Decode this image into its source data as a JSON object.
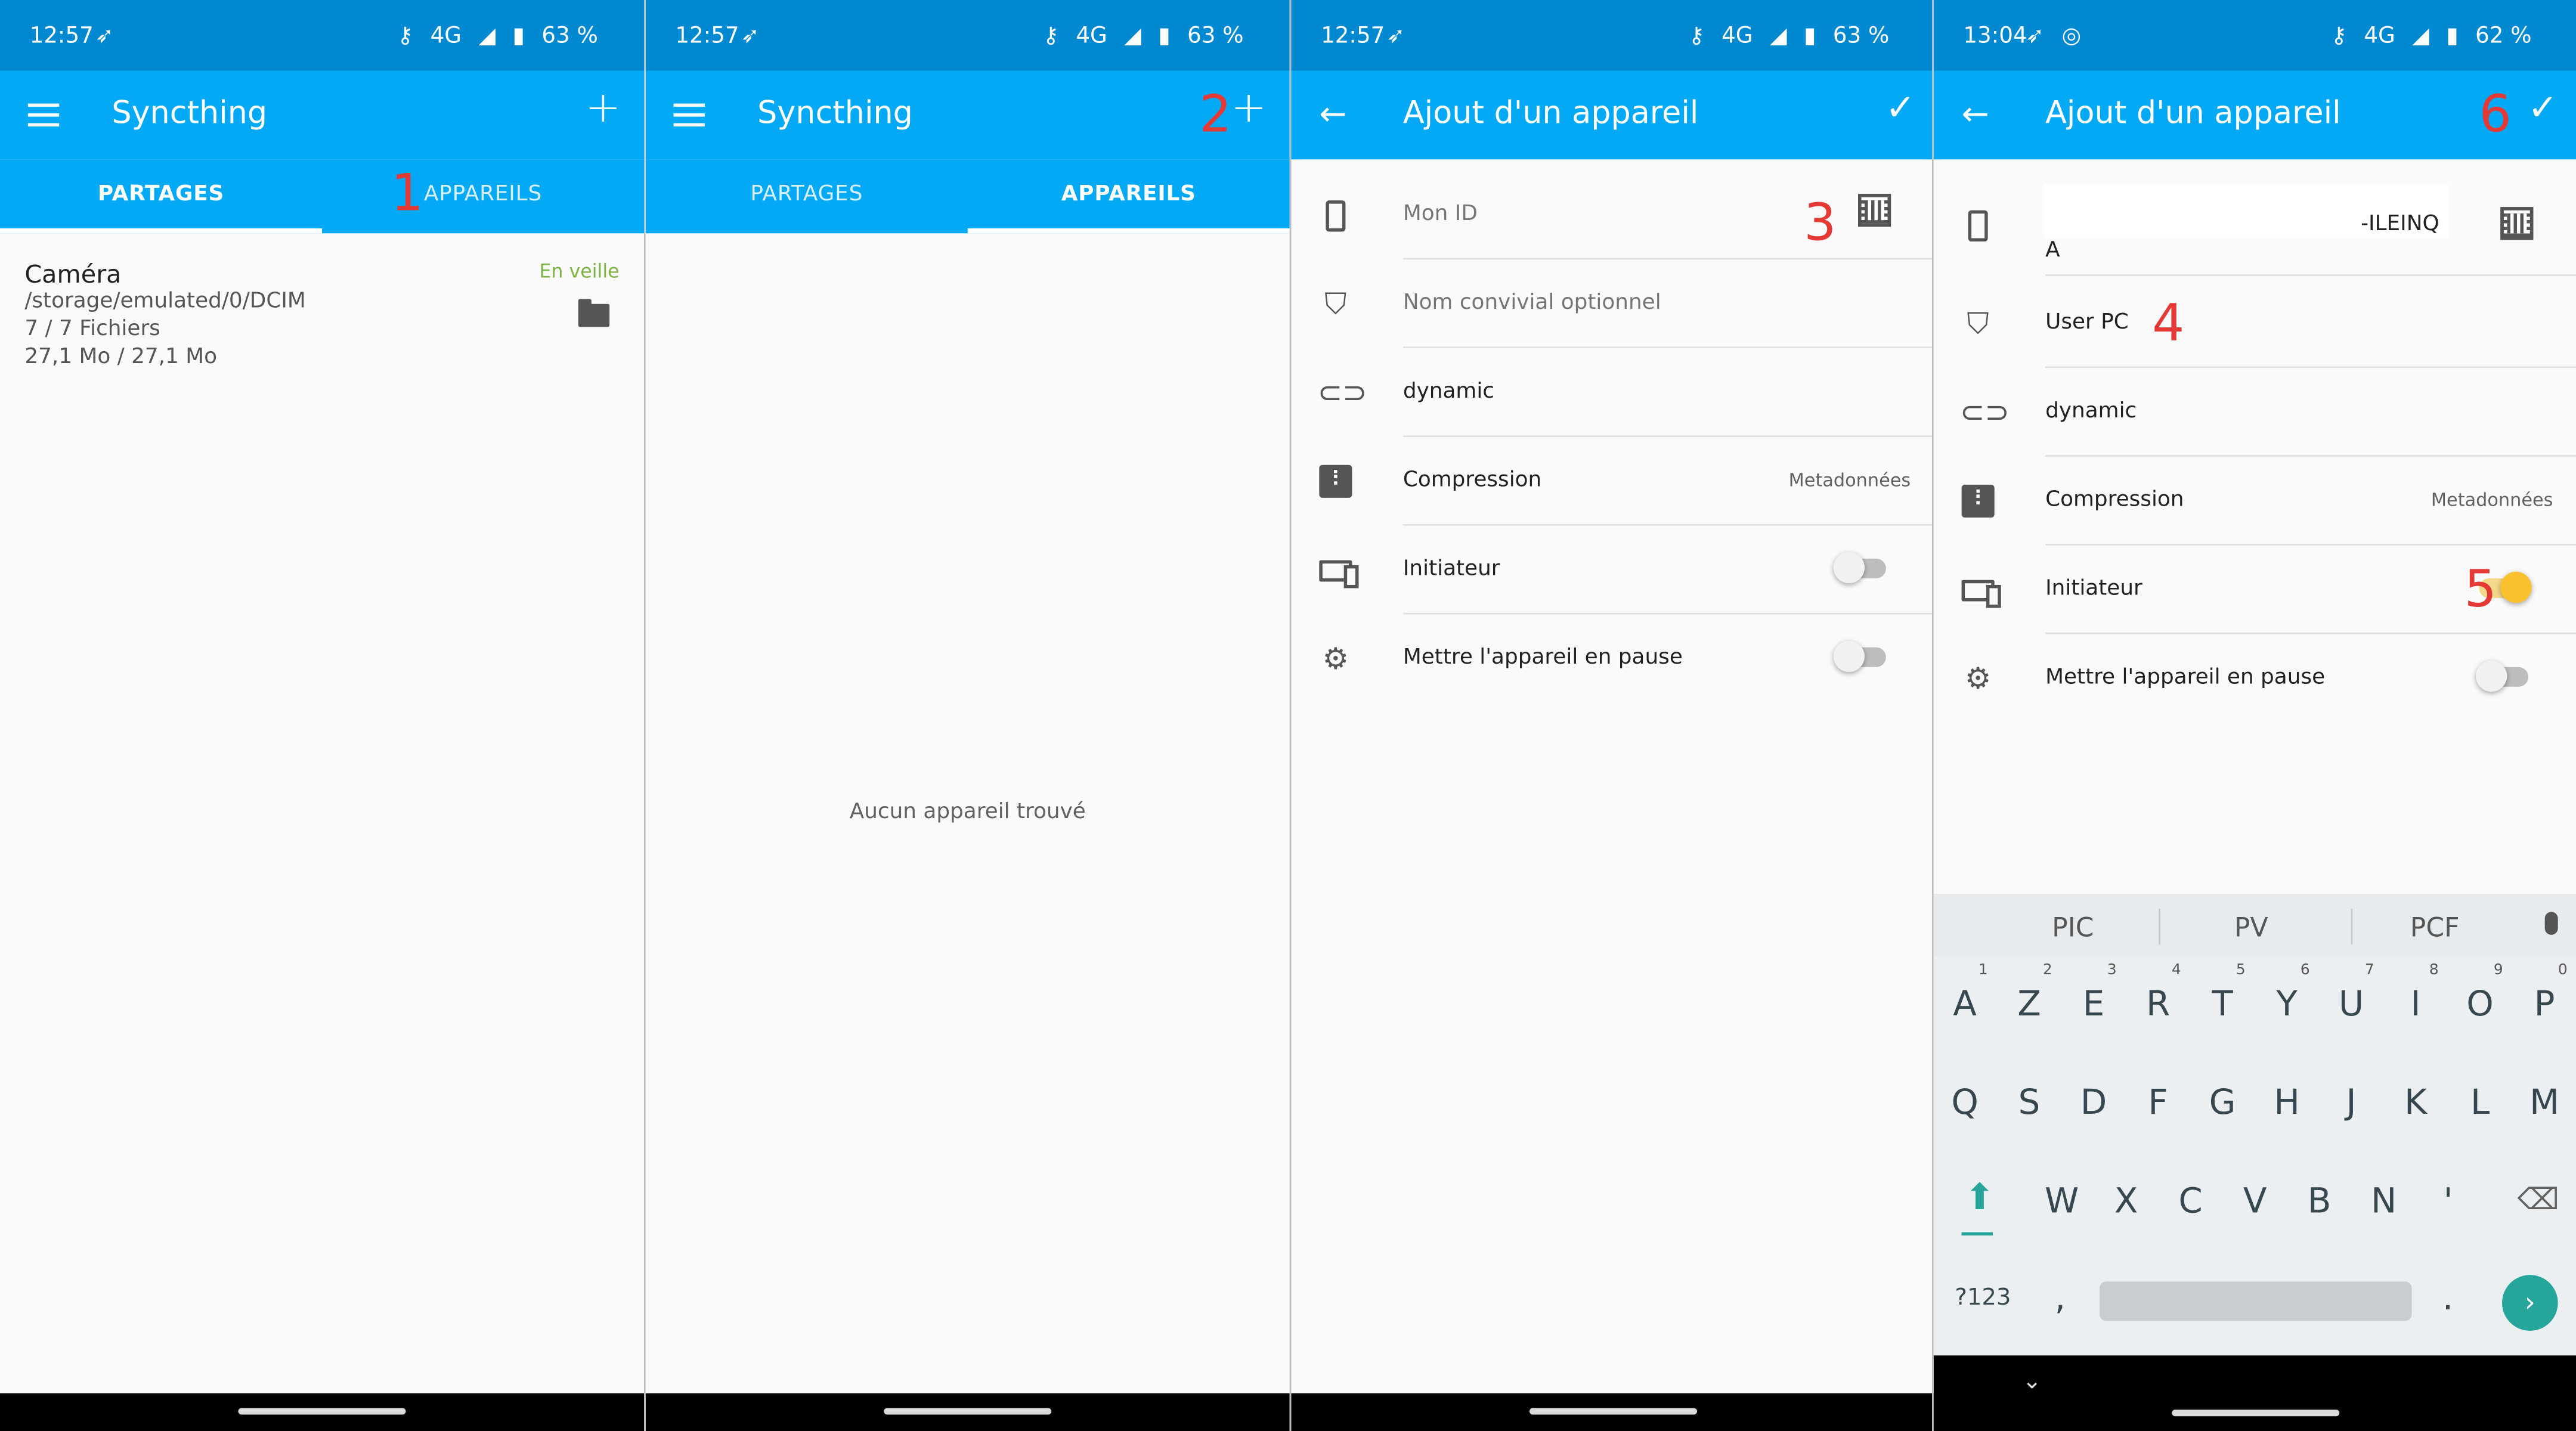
{
  "status_bars": [
    {
      "time": "12:57",
      "signal": "4G",
      "battery": "63 %"
    },
    {
      "time": "12:57",
      "signal": "4G",
      "battery": "63 %"
    },
    {
      "time": "12:57",
      "signal": "4G",
      "battery": "63 %"
    },
    {
      "time": "13:04",
      "signal": "4G",
      "battery": "62 %"
    }
  ],
  "screen1": {
    "title": "Syncthing",
    "tabs": [
      "PARTAGES",
      "APPAREILS"
    ],
    "folder": {
      "name": "Caméra",
      "path": "/storage/emulated/0/DCIM",
      "files": "7 / 7 Fichiers",
      "size": "27,1 Mo / 27,1 Mo",
      "status": "En veille"
    }
  },
  "screen2": {
    "title": "Syncthing",
    "tabs": [
      "PARTAGES",
      "APPAREILS"
    ],
    "empty_message": "Aucun appareil trouvé"
  },
  "screen3": {
    "title": "Ajout d'un appareil",
    "device_id_placeholder": "Mon ID",
    "name_placeholder": "Nom convivial optionnel",
    "address": "dynamic",
    "compression_label": "Compression",
    "compression_value": "Metadonnées",
    "introducer_label": "Initiateur",
    "pause_label": "Mettre l'appareil en pause",
    "introducer_on": false,
    "pause_on": false
  },
  "screen4": {
    "title": "Ajout d'un appareil",
    "device_id_suffix": "-ILEINQ",
    "device_id_line2": "A",
    "name_value": "User PC",
    "address": "dynamic",
    "compression_label": "Compression",
    "compression_value": "Metadonnées",
    "introducer_label": "Initiateur",
    "pause_label": "Mettre l'appareil en pause",
    "introducer_on": true,
    "pause_on": false
  },
  "annotations": [
    "1",
    "2",
    "3",
    "4",
    "5",
    "6"
  ],
  "keyboard": {
    "suggestions": [
      "PIC",
      "PV",
      "PCF"
    ],
    "row1": [
      [
        "A",
        "1"
      ],
      [
        "Z",
        "2"
      ],
      [
        "E",
        "3"
      ],
      [
        "R",
        "4"
      ],
      [
        "T",
        "5"
      ],
      [
        "Y",
        "6"
      ],
      [
        "U",
        "7"
      ],
      [
        "I",
        "8"
      ],
      [
        "O",
        "9"
      ],
      [
        "P",
        "0"
      ]
    ],
    "row2": [
      "Q",
      "S",
      "D",
      "F",
      "G",
      "H",
      "J",
      "K",
      "L",
      "M"
    ],
    "row3": [
      "W",
      "X",
      "C",
      "V",
      "B",
      "N",
      "'"
    ],
    "symbols_key": "?123",
    "comma_key": ",",
    "period_key": "."
  },
  "colors": {
    "status_bar": "#0088d1",
    "app_bar": "#03a9f4",
    "annotation": "#e53935",
    "switch_on": "#fbc02d",
    "idle_status": "#7cb342",
    "enter_key": "#26a69a"
  }
}
